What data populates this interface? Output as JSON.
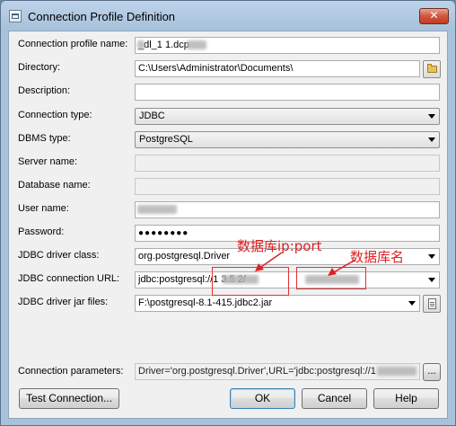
{
  "window": {
    "title": "Connection Profile Definition",
    "close_glyph": "✕"
  },
  "form": {
    "connection_profile_name": {
      "label": "Connection profile name:",
      "value": "_dl_1  1.dcp"
    },
    "directory": {
      "label": "Directory:",
      "value": "C:\\Users\\Administrator\\Documents\\"
    },
    "description": {
      "label": "Description:",
      "value": ""
    },
    "connection_type": {
      "label": "Connection type:",
      "value": "JDBC"
    },
    "dbms_type": {
      "label": "DBMS type:",
      "value": "PostgreSQL"
    },
    "server_name": {
      "label": "Server name:",
      "value": ""
    },
    "database_name": {
      "label": "Database name:",
      "value": ""
    },
    "user_name": {
      "label": "User name:",
      "value": ""
    },
    "password": {
      "label": "Password:",
      "value": "●●●●●●●●"
    },
    "jdbc_driver_class": {
      "label": "JDBC driver class:",
      "value": "org.postgresql.Driver"
    },
    "jdbc_connection_url": {
      "label": "JDBC connection URL:",
      "value": "jdbc:postgresql://1   3.5   2/"
    },
    "jdbc_driver_jar_files": {
      "label": "JDBC driver jar files:",
      "value": "F:\\postgresql-8.1-415.jdbc2.jar"
    },
    "connection_parameters": {
      "label": "Connection parameters:",
      "value": "Driver='org.postgresql.Driver',URL='jdbc:postgresql://1"
    },
    "ellipsis": "..."
  },
  "buttons": {
    "test_connection": "Test Connection...",
    "ok": "OK",
    "cancel": "Cancel",
    "help": "Help"
  },
  "annotations": {
    "ip_port": "数据库ip:port",
    "db_name": "数据库名"
  },
  "colors": {
    "annotation": "#e02020",
    "title_bar": "#a9c2dc"
  },
  "icons": [
    "app-icon",
    "close-icon",
    "folder-icon",
    "document-icon",
    "dropdown-arrow-icon"
  ]
}
